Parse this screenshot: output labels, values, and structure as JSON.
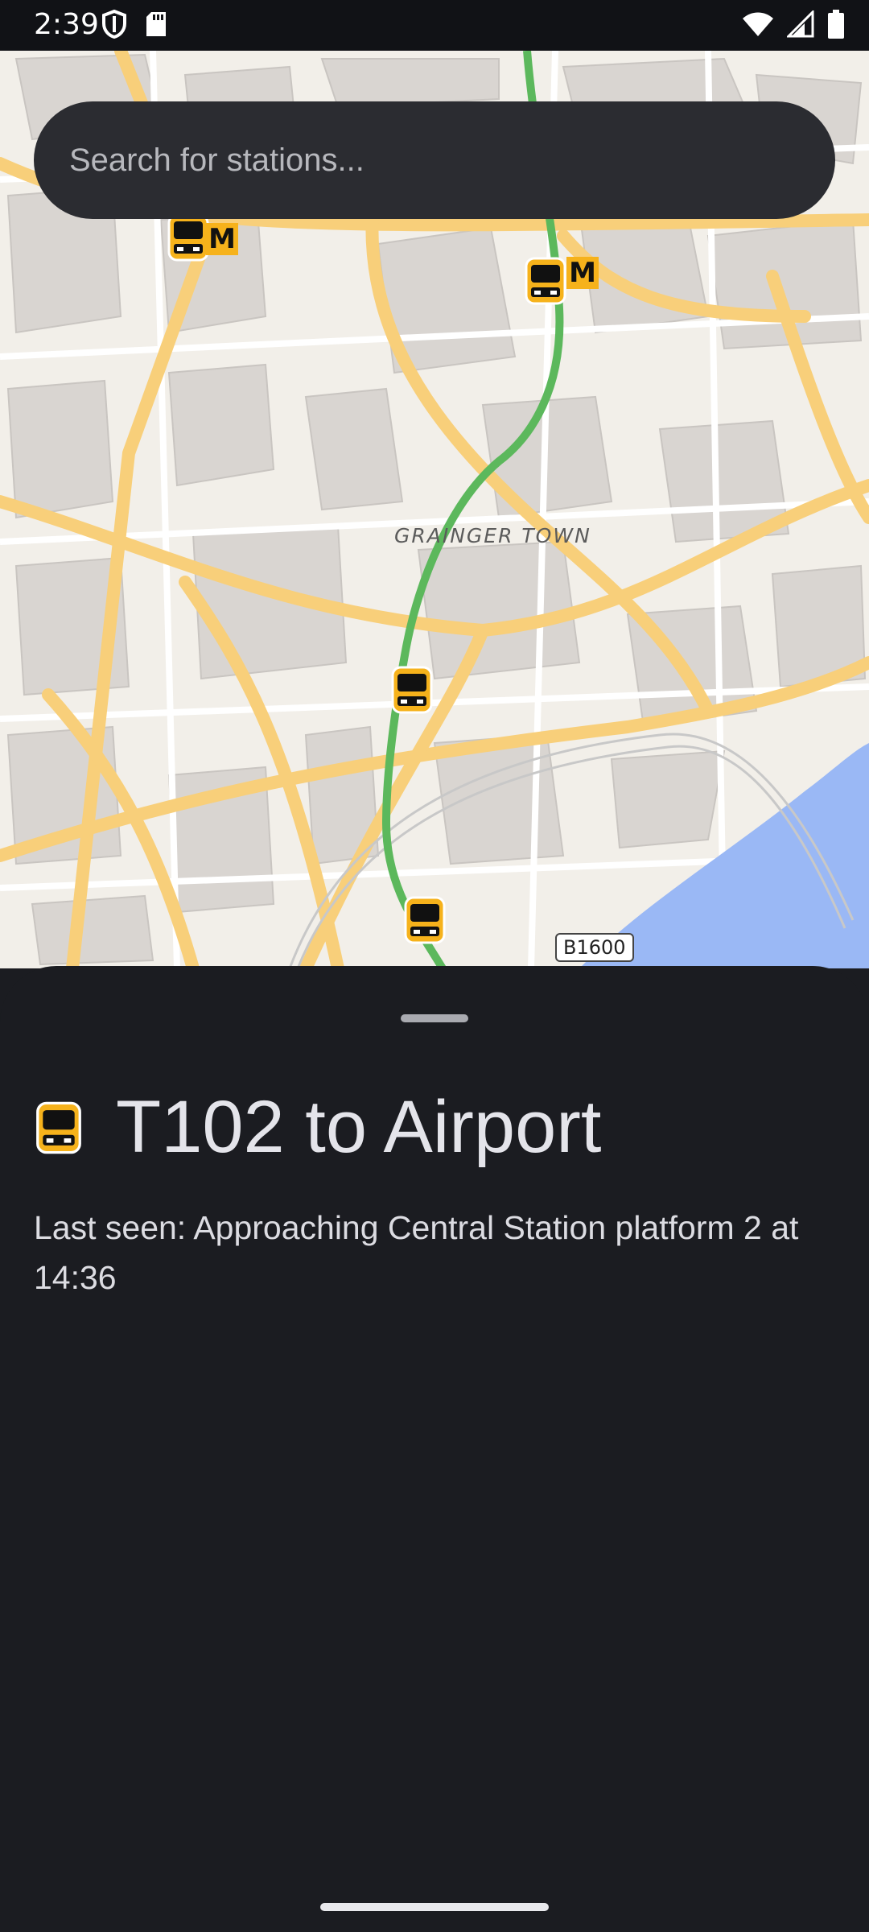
{
  "status_bar": {
    "time": "2:39",
    "icons": [
      "vpn-shield-icon",
      "sd-card-icon",
      "wifi-icon",
      "cellular-signal-icon",
      "battery-icon"
    ]
  },
  "search": {
    "placeholder": "Search for stations..."
  },
  "map": {
    "area_label": "GRAINGER TOWN",
    "road_shield": "B1600",
    "metro_badge": "M",
    "colors": {
      "land": "#f2efe9",
      "building": "#d9d5d1",
      "road": "#f8cf7a",
      "rail_line": "#5cb85c",
      "water": "#9ab8f5"
    }
  },
  "sheet": {
    "title": "T102 to Airport",
    "subtitle": "Last seen: Approaching Central Station platform 2 at 14:36"
  },
  "colors": {
    "accent": "#f6b21b",
    "sheet_bg": "#1b1c21",
    "search_bg": "#2b2c31"
  }
}
